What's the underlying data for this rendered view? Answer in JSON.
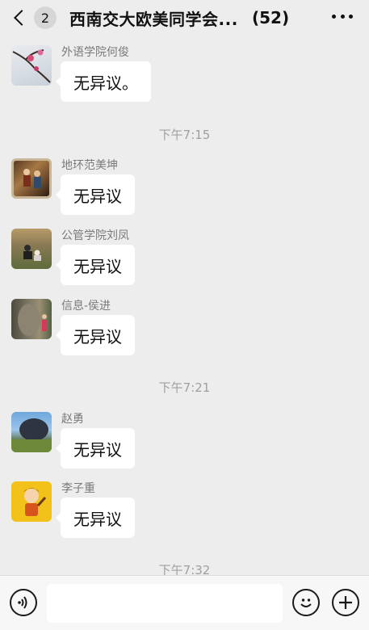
{
  "header": {
    "unread_count": "2",
    "title": "西南交大欧美同学会...",
    "member_count": "(52)"
  },
  "messages": [
    {
      "sender": "外语学院何俊",
      "text": "无异议。",
      "avatar": "plum-blossom-avatar"
    },
    {
      "sender": "地环范美坤",
      "text": "无异议",
      "avatar": "painting-avatar"
    },
    {
      "sender": "公管学院刘凤",
      "text": "无异议",
      "avatar": "park-photo-avatar"
    },
    {
      "sender": "信息-侯进",
      "text": "无异议",
      "avatar": "rock-photo-avatar"
    },
    {
      "sender": "赵勇",
      "text": "无异议",
      "avatar": "dome-photo-avatar"
    },
    {
      "sender": "李子重",
      "text": "无异议",
      "avatar": "cartoon-avatar"
    }
  ],
  "timestamps": [
    "下午7:15",
    "下午7:21",
    "下午7:32"
  ],
  "footer": {
    "input_placeholder": "",
    "icons": [
      "voice-icon",
      "emoji-icon",
      "plus-icon"
    ]
  }
}
